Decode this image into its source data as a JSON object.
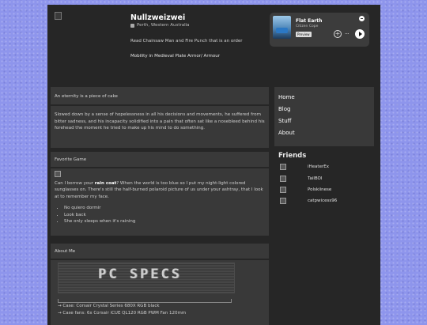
{
  "profile": {
    "username": "Nullzweizwei",
    "location_icon": "robot-icon",
    "location": "Perth, Western Australia",
    "bio": "Read Chainsaw Man and Fire Punch that is an order",
    "mood": "Mobility in Medieval Plate Armor/ Armour"
  },
  "spotify": {
    "title": "Flat Earth",
    "artist": "Citizen Cope",
    "preview_label": "Preview",
    "more_label": "···"
  },
  "about_box": {
    "title": "An eternity is a piece of cake",
    "body": "Slowed down by a sense of hopelessness in all his decisions and movements, he suffered from bitter sadness, and his incapacity solidified into a pain that often sat like a nosebleed behind his forehead the moment he tried to make up his mind to do something."
  },
  "favorite_game": {
    "title": "Favorite Game",
    "text_before": "Can I borrow your ",
    "highlight": "rain coat",
    "text_after": "? When the world is too blue so I put my night-light colored sunglasses on. There's still the half-burned polaroid picture of us under your ashtray, that I look at to remember my face.",
    "list": [
      "No quiero dormir",
      "Look back",
      "She only sleeps when it's raining"
    ]
  },
  "about_me": {
    "title": "About Me",
    "ascii_art": "PC SPECS",
    "specs": [
      "→ Case: Corsair Crystal Series 680X RGB black",
      "→ Case fans: 6x Corsair iCUE QL120 RGB PWM Fan 120mm"
    ]
  },
  "nav": {
    "items": [
      "Home",
      "Blog",
      "Stuff",
      "About"
    ]
  },
  "friends": {
    "title": "Friends",
    "list": [
      "iHeaterEx",
      "TailBOI",
      "Polskiinese",
      "catpwicess96"
    ]
  },
  "colors": {
    "page_bg": "#8e95ec",
    "panel_bg": "#262626",
    "box_bg": "#393939"
  }
}
